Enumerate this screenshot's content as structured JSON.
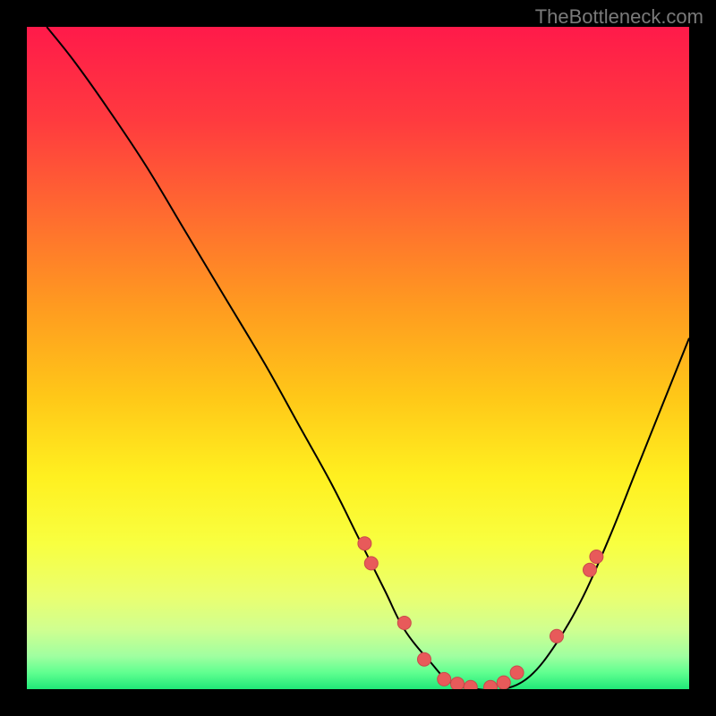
{
  "watermark": "TheBottleneck.com",
  "colors": {
    "background": "#000000",
    "curve_stroke": "#000000",
    "dot_fill": "#e85a5a",
    "dot_stroke": "#c94a4a"
  },
  "chart_data": {
    "type": "line",
    "title": "",
    "xlabel": "",
    "ylabel": "",
    "xlim": [
      0,
      100
    ],
    "ylim": [
      0,
      100
    ],
    "series": [
      {
        "name": "bottleneck-curve",
        "x": [
          3,
          7,
          12,
          18,
          24,
          30,
          36,
          41,
          46,
          50,
          54,
          57,
          61,
          64,
          68,
          72,
          76,
          80,
          84,
          88,
          92,
          96,
          100
        ],
        "y": [
          100,
          95,
          88,
          79,
          69,
          59,
          49,
          40,
          31,
          23,
          15,
          9,
          4,
          1,
          0,
          0,
          2,
          7,
          14,
          23,
          33,
          43,
          53
        ]
      }
    ],
    "data_points": [
      {
        "x": 51,
        "y": 22
      },
      {
        "x": 52,
        "y": 19
      },
      {
        "x": 57,
        "y": 10
      },
      {
        "x": 60,
        "y": 4.5
      },
      {
        "x": 63,
        "y": 1.5
      },
      {
        "x": 65,
        "y": 0.8
      },
      {
        "x": 67,
        "y": 0.3
      },
      {
        "x": 70,
        "y": 0.3
      },
      {
        "x": 72,
        "y": 1
      },
      {
        "x": 74,
        "y": 2.5
      },
      {
        "x": 80,
        "y": 8
      },
      {
        "x": 85,
        "y": 18
      },
      {
        "x": 86,
        "y": 20
      }
    ],
    "gradient_stops": [
      {
        "offset": 0,
        "color": "#ff1a4a"
      },
      {
        "offset": 0.14,
        "color": "#ff3a3f"
      },
      {
        "offset": 0.28,
        "color": "#ff6a30"
      },
      {
        "offset": 0.42,
        "color": "#ff9a20"
      },
      {
        "offset": 0.56,
        "color": "#ffc818"
      },
      {
        "offset": 0.68,
        "color": "#fff020"
      },
      {
        "offset": 0.78,
        "color": "#f8ff40"
      },
      {
        "offset": 0.86,
        "color": "#eaff70"
      },
      {
        "offset": 0.91,
        "color": "#d0ff90"
      },
      {
        "offset": 0.95,
        "color": "#a0ffa0"
      },
      {
        "offset": 0.975,
        "color": "#60ff90"
      },
      {
        "offset": 1.0,
        "color": "#20e878"
      }
    ]
  }
}
